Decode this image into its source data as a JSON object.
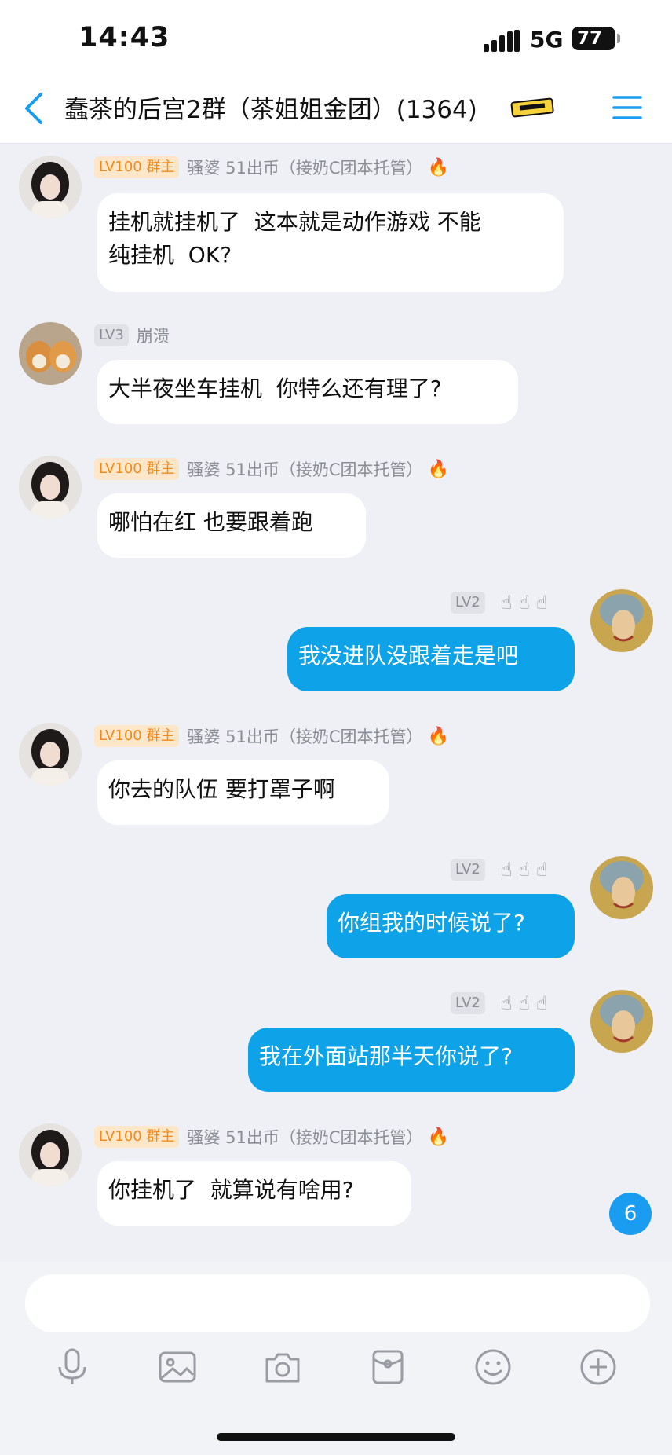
{
  "status_bar": {
    "time": "14:43",
    "network": "5G",
    "battery": "77"
  },
  "header": {
    "title": "蠢茶的后宫2群（茶姐姐金团）(1364)"
  },
  "messages": [
    {
      "level": "LV100",
      "role": "群主",
      "name": "骚婆 51出币（接奶C团本托管）",
      "text": "挂机就挂机了  这本就是动作游戏 不能\n纯挂机  OK?"
    },
    {
      "level": "LV3",
      "name": "崩溃",
      "text": "大半夜坐车挂机  你特么还有理了?"
    },
    {
      "level": "LV100",
      "role": "群主",
      "name": "骚婆 51出币（接奶C团本托管）",
      "text": "哪怕在红 也要跟着跑"
    },
    {
      "level": "LV2",
      "text": "我没进队没跟着走是吧"
    },
    {
      "level": "LV100",
      "role": "群主",
      "name": "骚婆 51出币（接奶C团本托管）",
      "text": "你去的队伍 要打罩子啊"
    },
    {
      "level": "LV2",
      "text": "你组我的时候说了?"
    },
    {
      "level": "LV2",
      "text": "我在外面站那半天你说了?"
    },
    {
      "level": "LV100",
      "role": "群主",
      "name": "骚婆 51出币（接奶C团本托管）",
      "text": "你挂机了  就算说有啥用?"
    }
  ],
  "unread_count": "6",
  "input": {
    "placeholder": ""
  },
  "colors": {
    "outgoing_bubble": "#0ea3e8",
    "accent": "#1a9df0",
    "owner_badge": "#f08a1c"
  },
  "icons": [
    "back-icon",
    "menu-icon",
    "mic-icon",
    "image-icon",
    "camera-icon",
    "red-packet-icon",
    "emoji-icon",
    "plus-icon"
  ]
}
